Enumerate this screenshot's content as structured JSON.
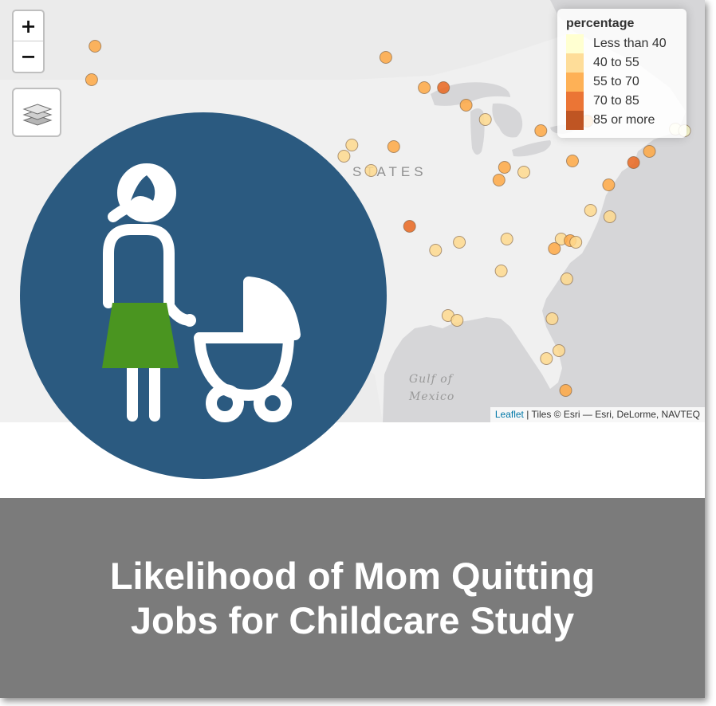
{
  "map": {
    "zoom_in_label": "+",
    "zoom_out_label": "−",
    "layers_icon": "layers-icon",
    "place_labels": {
      "country": "STATES",
      "gulf_line1": "Gulf of",
      "gulf_line2": "Mexico"
    },
    "attribution": {
      "link": "Leaflet",
      "text": " | Tiles © Esri — Esri, DeLorme, NAVTEQ"
    },
    "legend": {
      "title": "percentage",
      "items": [
        {
          "label": "Less than 40",
          "color": "#ffffcc"
        },
        {
          "label": "40 to 55",
          "color": "#fed98e"
        },
        {
          "label": "55 to 70",
          "color": "#fea844"
        },
        {
          "label": "70 to 85",
          "color": "#e9661f"
        },
        {
          "label": "85 or more",
          "color": "#b8420b"
        }
      ]
    },
    "markers": [
      {
        "lon": -122.4,
        "lat": 47.6,
        "class": "55 to 70"
      },
      {
        "lon": -122.7,
        "lat": 45.5,
        "class": "55 to 70"
      },
      {
        "lon": -121.5,
        "lat": 38.6,
        "class": "55 to 70"
      },
      {
        "lon": -122.3,
        "lat": 37.8,
        "class": "55 to 70"
      },
      {
        "lon": -121.9,
        "lat": 37.3,
        "class": "55 to 70"
      },
      {
        "lon": -96.7,
        "lat": 46.9,
        "class": "55 to 70"
      },
      {
        "lon": -93.3,
        "lat": 45.0,
        "class": "55 to 70"
      },
      {
        "lon": -91.6,
        "lat": 45.0,
        "class": "70 to 85"
      },
      {
        "lon": -87.9,
        "lat": 43.0,
        "class": "40 to 55"
      },
      {
        "lon": -83.0,
        "lat": 42.3,
        "class": "55 to 70"
      },
      {
        "lon": -78.9,
        "lat": 42.9,
        "class": "55 to 70"
      },
      {
        "lon": -89.6,
        "lat": 43.9,
        "class": "55 to 70"
      },
      {
        "lon": -96.0,
        "lat": 41.3,
        "class": "55 to 70"
      },
      {
        "lon": -99.7,
        "lat": 41.4,
        "class": "40 to 55"
      },
      {
        "lon": -100.4,
        "lat": 40.7,
        "class": "40 to 55"
      },
      {
        "lon": -98.0,
        "lat": 39.8,
        "class": "40 to 55"
      },
      {
        "lon": -86.2,
        "lat": 40.0,
        "class": "55 to 70"
      },
      {
        "lon": -86.7,
        "lat": 39.2,
        "class": "55 to 70"
      },
      {
        "lon": -84.5,
        "lat": 39.7,
        "class": "40 to 55"
      },
      {
        "lon": -80.2,
        "lat": 40.4,
        "class": "55 to 70"
      },
      {
        "lon": -77.0,
        "lat": 38.9,
        "class": "55 to 70"
      },
      {
        "lon": -74.8,
        "lat": 40.3,
        "class": "70 to 85"
      },
      {
        "lon": -73.4,
        "lat": 41.0,
        "class": "55 to 70"
      },
      {
        "lon": -71.1,
        "lat": 42.4,
        "class": "Less than 40"
      },
      {
        "lon": -70.3,
        "lat": 42.3,
        "class": "Less than 40"
      },
      {
        "lon": -78.6,
        "lat": 37.3,
        "class": "40 to 55"
      },
      {
        "lon": -76.9,
        "lat": 36.9,
        "class": "40 to 55"
      },
      {
        "lon": -94.6,
        "lat": 36.3,
        "class": "70 to 85"
      },
      {
        "lon": -90.2,
        "lat": 35.3,
        "class": "40 to 55"
      },
      {
        "lon": -86.0,
        "lat": 35.5,
        "class": "40 to 55"
      },
      {
        "lon": -81.2,
        "lat": 35.5,
        "class": "40 to 55"
      },
      {
        "lon": -80.4,
        "lat": 35.4,
        "class": "55 to 70"
      },
      {
        "lon": -79.9,
        "lat": 35.3,
        "class": "40 to 55"
      },
      {
        "lon": -81.8,
        "lat": 34.9,
        "class": "55 to 70"
      },
      {
        "lon": -92.3,
        "lat": 34.8,
        "class": "40 to 55"
      },
      {
        "lon": -86.5,
        "lat": 33.5,
        "class": "40 to 55"
      },
      {
        "lon": -80.7,
        "lat": 33.0,
        "class": "40 to 55"
      },
      {
        "lon": -91.2,
        "lat": 30.7,
        "class": "40 to 55"
      },
      {
        "lon": -90.4,
        "lat": 30.4,
        "class": "40 to 55"
      },
      {
        "lon": -82.0,
        "lat": 30.5,
        "class": "40 to 55"
      },
      {
        "lon": -82.5,
        "lat": 28.0,
        "class": "40 to 55"
      },
      {
        "lon": -81.4,
        "lat": 28.5,
        "class": "40 to 55"
      },
      {
        "lon": -80.8,
        "lat": 26.0,
        "class": "55 to 70"
      }
    ]
  },
  "banner": {
    "line1": "Likelihood of Mom Quitting",
    "line2": "Jobs for Childcare Study"
  },
  "colors": {
    "icon_circle": "#2b5a80",
    "skirt": "#4a9520",
    "banner": "#7b7b7b",
    "land": "#f0f0f0",
    "water": "#d6d6d8"
  }
}
